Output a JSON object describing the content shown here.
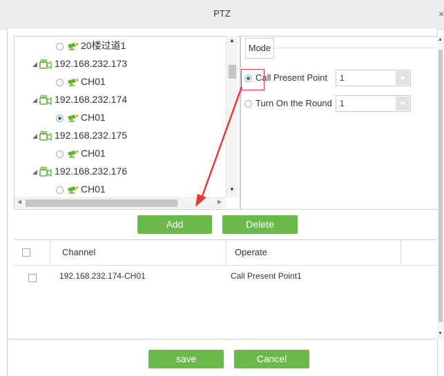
{
  "window": {
    "title": "PTZ",
    "close_glyph": "×"
  },
  "tree": {
    "rows": [
      {
        "type": "channel",
        "label": "20楼过道1",
        "selected": false
      },
      {
        "type": "device",
        "label": "192.168.232.173"
      },
      {
        "type": "channel",
        "label": "CH01",
        "selected": false
      },
      {
        "type": "device",
        "label": "192.168.232.174"
      },
      {
        "type": "channel",
        "label": "CH01",
        "selected": true
      },
      {
        "type": "device",
        "label": "192.168.232.175"
      },
      {
        "type": "channel",
        "label": "CH01",
        "selected": false
      },
      {
        "type": "device",
        "label": "192.168.232.176"
      },
      {
        "type": "channel",
        "label": "CH01",
        "selected": false
      }
    ]
  },
  "mode": {
    "legend": "Mode",
    "options": [
      {
        "label": "Call Present Point",
        "selected": true,
        "value": "1"
      },
      {
        "label": "Turn On the Round",
        "selected": false,
        "value": "1"
      }
    ]
  },
  "buttons": {
    "add": "Add",
    "delete": "Delete",
    "save": "save",
    "cancel": "Cancel"
  },
  "table": {
    "headers": {
      "channel": "Channel",
      "operate": "Operate"
    },
    "rows": [
      {
        "channel": "192.168.232.174-CH01",
        "operate": "Call Present Point1",
        "checked": false
      }
    ]
  },
  "colors": {
    "accent_green": "#6bb84b",
    "annotation_red": "#e53935",
    "device_icon_green": "#5cb531"
  },
  "icons": {
    "device": "camera-group-icon",
    "channel": "camera-icon",
    "expander": "triangle-expand-icon",
    "dropdown": "chevron-down-icon"
  }
}
